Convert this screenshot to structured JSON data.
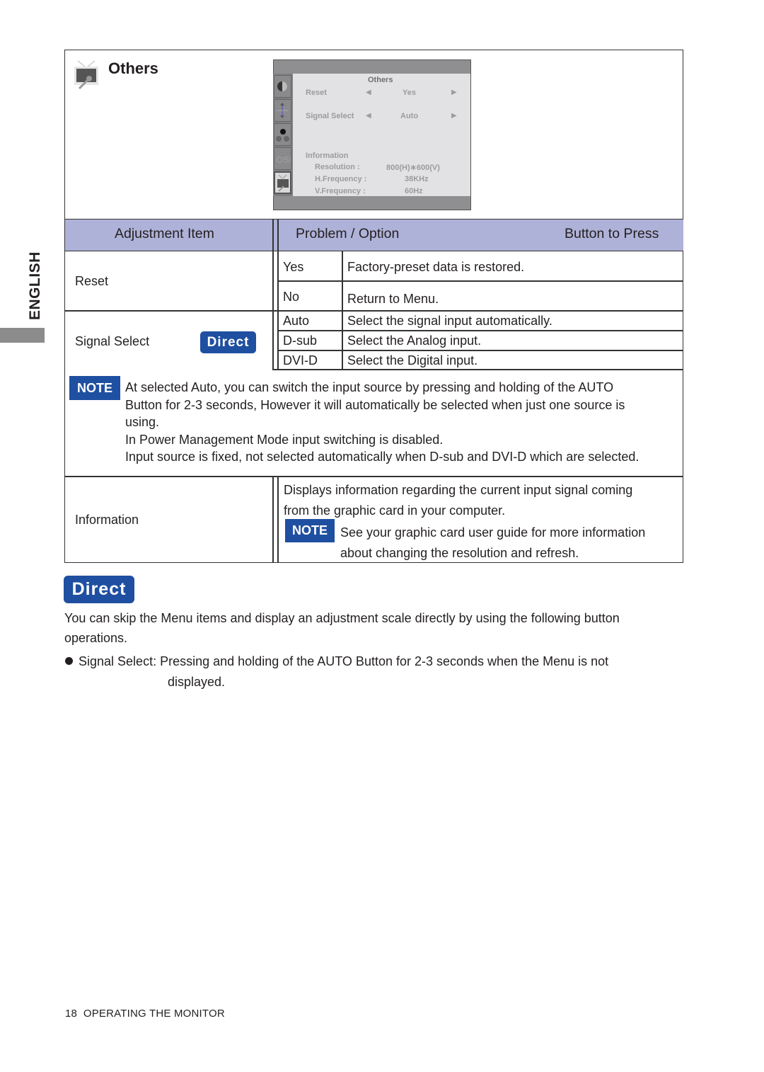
{
  "side_tab": {
    "language": "ENGLISH"
  },
  "section": {
    "title": "Others",
    "icon": "others-tv-wrench-icon"
  },
  "osd": {
    "title": "Others",
    "tabs": [
      "contrast-brightness-icon",
      "position-arrows-icon",
      "color-dots-icon",
      "osd-icon",
      "others-tv-wrench-icon"
    ],
    "rows": [
      {
        "label": "Reset",
        "value": "Yes"
      },
      {
        "label": "Signal Select",
        "value": "Auto"
      }
    ],
    "info_title": "Information",
    "info": [
      {
        "label": "Resolution :",
        "value": "800(H)∗600(V)"
      },
      {
        "label": "H.Frequency :",
        "value": "38KHz"
      },
      {
        "label": "V.Frequency :",
        "value": "60Hz"
      }
    ]
  },
  "table": {
    "headers": {
      "item": "Adjustment Item",
      "option": "Problem / Option",
      "button": "Button to Press"
    },
    "reset": {
      "label": "Reset",
      "options": [
        {
          "option": "Yes",
          "desc": "Factory-preset data is restored."
        },
        {
          "option": "No",
          "desc": "Return to Menu."
        }
      ]
    },
    "signal": {
      "label": "Signal Select",
      "badge": "Direct",
      "options": [
        {
          "option": "Auto",
          "desc": "Select the signal input automatically."
        },
        {
          "option": "D-sub",
          "desc": "Select the Analog input."
        },
        {
          "option": "DVI-D",
          "desc": "Select the Digital input."
        }
      ],
      "note_badge": "NOTE",
      "note_lines": [
        "At selected Auto, you can switch the input source by pressing and holding of the AUTO",
        "Button for 2-3 seconds, However it will automatically be selected when just one source is",
        "using.",
        "In Power Management Mode input switching is disabled.",
        "Input source is fixed, not selected automatically when D-sub and DVI-D which are selected."
      ]
    },
    "information": {
      "label": "Information",
      "desc_lines": [
        "Displays information regarding the current input signal coming",
        "from the graphic card in your computer."
      ],
      "note_badge": "NOTE",
      "note_lines": [
        "See your graphic card user guide for more information",
        "about changing the resolution and refresh."
      ]
    }
  },
  "direct": {
    "badge": "Direct",
    "intro_lines": [
      "You can skip the Menu items and display an adjustment scale directly by using the following button",
      "operations."
    ],
    "bullet_label": "Signal Select:",
    "bullet_text": "Pressing and holding of the AUTO Button for 2-3 seconds when the Menu is not",
    "bullet_cont": "displayed."
  },
  "footer": {
    "page": "18",
    "title": "OPERATING THE MONITOR"
  },
  "colors": {
    "accent_blue": "#1f4fa0",
    "header_lavender": "#afb2d8",
    "osd_gray": "#8f8f92"
  }
}
